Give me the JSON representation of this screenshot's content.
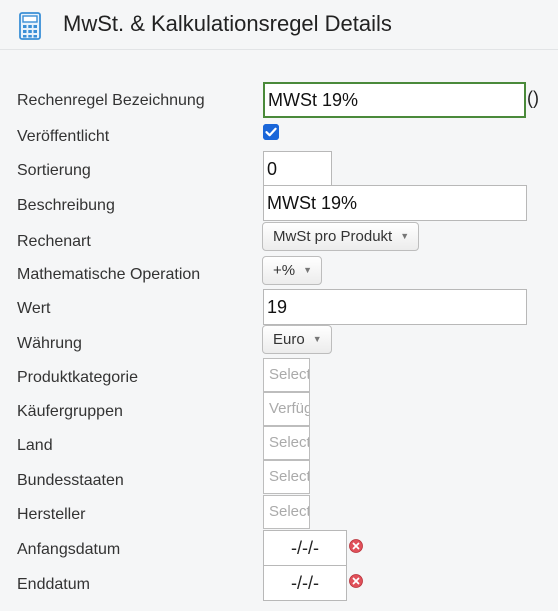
{
  "header": {
    "title": "MwSt. & Kalkulationsregel Details",
    "icon": "calculator-icon"
  },
  "form": {
    "rule_name": {
      "label": "Rechenregel Bezeichnung",
      "value": "MWSt 19%",
      "suffix": "()"
    },
    "published": {
      "label": "Veröffentlicht",
      "checked": true
    },
    "ordering": {
      "label": "Sortierung",
      "value": "0"
    },
    "description": {
      "label": "Beschreibung",
      "value": "MWSt 19%"
    },
    "calc_kind": {
      "label": "Rechenart",
      "value": "MwSt pro Produkt"
    },
    "math_op": {
      "label": "Mathematische Operation",
      "value": "+%"
    },
    "value": {
      "label": "Wert",
      "value": "19"
    },
    "currency": {
      "label": "Währung",
      "value": "Euro"
    },
    "product_category": {
      "label": "Produktkategorie",
      "placeholder": "Select"
    },
    "shopper_groups": {
      "label": "Käufergruppen",
      "placeholder": "Verfügbar"
    },
    "country": {
      "label": "Land",
      "placeholder": "Select"
    },
    "states": {
      "label": "Bundesstaaten",
      "placeholder": "Select"
    },
    "manufacturer": {
      "label": "Hersteller",
      "placeholder": "Select"
    },
    "start_date": {
      "label": "Anfangsdatum",
      "value": "-/-/-"
    },
    "end_date": {
      "label": "Enddatum",
      "value": "-/-/-"
    }
  },
  "colors": {
    "accent_focus": "#4a8a3a",
    "checkbox": "#1a66d9",
    "clear_icon": "#e0505a"
  }
}
